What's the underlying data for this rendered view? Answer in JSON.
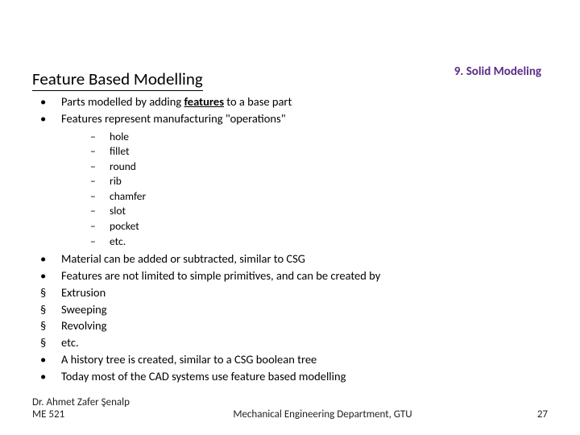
{
  "chapter": "9. Solid Modeling",
  "title": "Feature Based Modelling",
  "points": {
    "p1_pre": "Parts modelled by adding ",
    "p1_feat": "features",
    "p1_post": " to a base part",
    "p2": "Features represent manufacturing \"operations\"",
    "sub": [
      "hole",
      "fillet",
      "round",
      "rib",
      "chamfer",
      "slot",
      "pocket",
      "etc."
    ],
    "p3": "Material can be added or subtracted, similar to CSG",
    "p4": "Features are not limited to simple primitives, and can be created by",
    "p5": "Extrusion",
    "p6": "Sweeping",
    "p7": "Revolving",
    "p8": "etc.",
    "p9": "A history tree is created, similar to a CSG boolean tree",
    "p10": "Today most of the CAD systems use feature based modelling"
  },
  "bullets": {
    "dot": "•",
    "dash": "–",
    "square": "§"
  },
  "footer": {
    "author": "Dr. Ahmet Zafer Şenalp",
    "course": "ME 521",
    "dept": "Mechanical Engineering Department, GTU",
    "page": "27"
  }
}
